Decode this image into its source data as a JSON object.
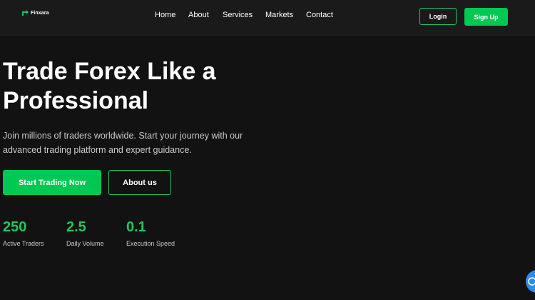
{
  "brand": {
    "name": "Finxara",
    "accent_color": "#22c55e",
    "button_color": "#00c853"
  },
  "nav": {
    "items": [
      {
        "label": "Home"
      },
      {
        "label": "About"
      },
      {
        "label": "Services"
      },
      {
        "label": "Markets"
      },
      {
        "label": "Contact"
      }
    ]
  },
  "auth": {
    "login_label": "Login",
    "signup_label": "Sign Up"
  },
  "hero": {
    "title_line1": "Trade Forex Like a",
    "title_line2": "Professional",
    "subtitle": "Join millions of traders worldwide. Start your journey with our advanced trading platform and expert guidance.",
    "primary_cta": "Start Trading Now",
    "secondary_cta": "About us"
  },
  "stats": [
    {
      "value": "250",
      "label": "Active Traders"
    },
    {
      "value": "2.5",
      "label": "Daily Volume"
    },
    {
      "value": "0.1",
      "label": "Execution Speed"
    }
  ],
  "widgets": {
    "chat_icon": "chat-icon"
  }
}
